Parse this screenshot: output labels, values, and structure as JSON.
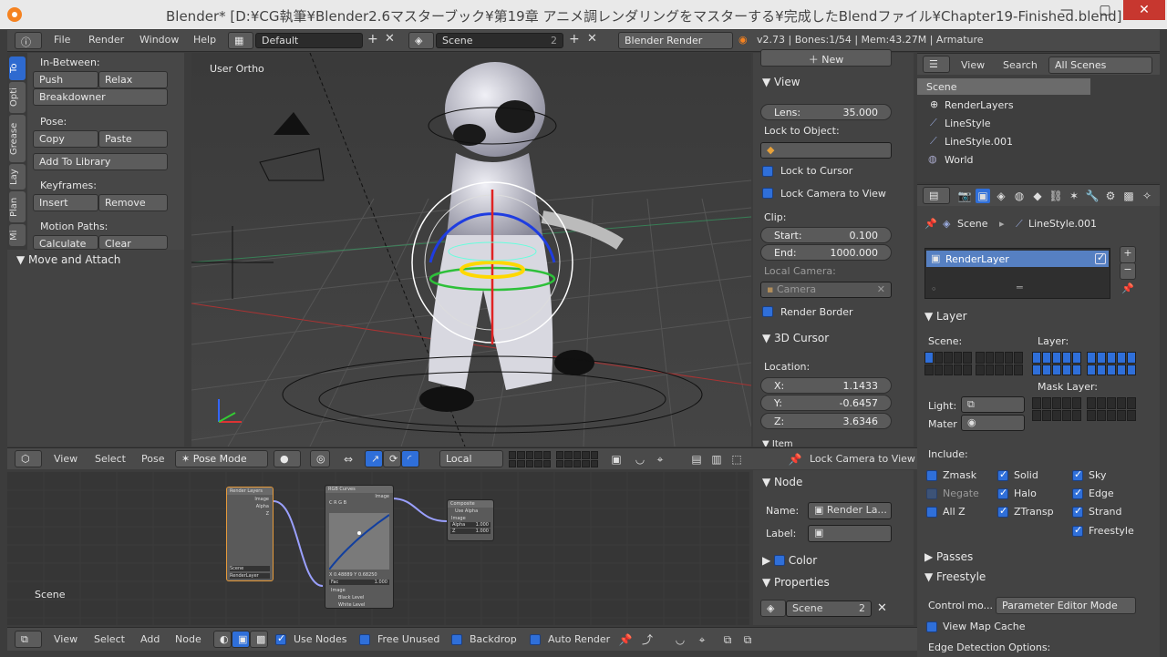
{
  "window": {
    "title": "Blender* [D:¥CG執筆¥Blender2.6マスターブック¥第19章 アニメ調レンダリングをマスターする¥完成したBlendファイル¥Chapter19-Finished.blend]",
    "minimize": "—",
    "maximize": "▢",
    "close": "✕"
  },
  "menubar": {
    "menus": [
      "File",
      "Render",
      "Window",
      "Help"
    ],
    "layout": "Default",
    "scene": "Scene",
    "scene_users": "2",
    "engine": "Blender Render",
    "stats": "v2.73 | Bones:1/54 | Mem:43.27M | Armature"
  },
  "toolshelf": {
    "tabs": [
      "To",
      "Opti",
      "Grease",
      "Lay",
      "Plan",
      "Mi"
    ],
    "inbetween_label": "In-Between:",
    "push": "Push",
    "relax": "Relax",
    "breakdowner": "Breakdowner",
    "pose_label": "Pose:",
    "copy": "Copy",
    "paste": "Paste",
    "add_to_library": "Add To Library",
    "keyframes_label": "Keyframes:",
    "insert": "Insert",
    "remove": "Remove",
    "motion_paths_label": "Motion Paths:",
    "calculate": "Calculate",
    "clear": "Clear",
    "move_attach": "Move and Attach"
  },
  "viewport": {
    "label": "User Ortho"
  },
  "view3d_header": {
    "view": "View",
    "select": "Select",
    "pose": "Pose",
    "mode": "Pose Mode",
    "orientation": "Local",
    "lock_camera": "Lock Camera to View"
  },
  "npanel": {
    "new": "New",
    "view_header": "View",
    "lens_label": "Lens:",
    "lens_value": "35.000",
    "lock_to_object": "Lock to Object:",
    "lock_to_cursor": "Lock to Cursor",
    "lock_camera_to_view": "Lock Camera to View",
    "clip_label": "Clip:",
    "start_label": "Start:",
    "start_value": "0.100",
    "end_label": "End:",
    "end_value": "1000.000",
    "local_camera": "Local Camera:",
    "camera": "Camera",
    "render_border": "Render Border",
    "cursor_header": "3D Cursor",
    "location_label": "Location:",
    "x_label": "X:",
    "x_value": "1.1433",
    "y_label": "Y:",
    "y_value": "-0.6457",
    "z_label": "Z:",
    "z_value": "3.6346",
    "item_header": "Item"
  },
  "node_panel": {
    "node_header": "Node",
    "name_label": "Name:",
    "name_value": "Render La...",
    "label_label": "Label:",
    "color_header": "Color",
    "properties_header": "Properties",
    "scene": "Scene",
    "scene_users": "2"
  },
  "node_editor": {
    "scene_label": "Scene",
    "render_layers_node": {
      "title": "Render Layers",
      "outputs": [
        "Image",
        "Alpha",
        "Z"
      ],
      "scene": "Scene",
      "layer": "RenderLayer"
    },
    "rgb_curves_node": {
      "title": "RGB Curves",
      "output": "Image",
      "channels": "C R G B",
      "x_readout": "X 0.48889",
      "y_readout": "Y 0.68250",
      "fac_label": "Fac",
      "fac_value": "1.000",
      "image_in": "Image",
      "black": "Black Level",
      "white": "White Level"
    },
    "composite_node": {
      "title": "Composite",
      "use_alpha": "Use Alpha",
      "image": "Image",
      "alpha_label": "Alpha",
      "alpha_value": "1.000",
      "z_label": "Z",
      "z_value": "1.000"
    }
  },
  "node_header": {
    "view": "View",
    "select": "Select",
    "add": "Add",
    "node": "Node",
    "use_nodes": "Use Nodes",
    "free_unused": "Free Unused",
    "backdrop": "Backdrop",
    "auto_render": "Auto Render"
  },
  "outliner": {
    "view": "View",
    "search": "Search",
    "filter": "All Scenes",
    "items": [
      "Scene",
      "RenderLayers",
      "LineStyle",
      "LineStyle.001",
      "World"
    ]
  },
  "properties": {
    "path_scene": "Scene",
    "path_linestyle": "LineStyle.001",
    "render_layer": "RenderLayer",
    "layer_header": "Layer",
    "scene_label": "Scene:",
    "layer_label": "Layer:",
    "mask_layer_label": "Mask Layer:",
    "light_label": "Light:",
    "mater_label": "Mater",
    "include_label": "Include:",
    "zmask": "Zmask",
    "negate": "Negate",
    "allz": "All Z",
    "solid": "Solid",
    "halo": "Halo",
    "ztransp": "ZTransp",
    "sky": "Sky",
    "edge": "Edge",
    "strand": "Strand",
    "freestyle_chk": "Freestyle",
    "passes_header": "Passes",
    "freestyle_header": "Freestyle",
    "control_mode_label": "Control mo...",
    "control_mode_value": "Parameter Editor Mode",
    "view_map_cache": "View Map Cache",
    "edge_detection": "Edge Detection Options:"
  },
  "colors": {
    "accent": "#2f6fd9",
    "active": "#5680c2",
    "title_bg": "#e9e9e9"
  }
}
